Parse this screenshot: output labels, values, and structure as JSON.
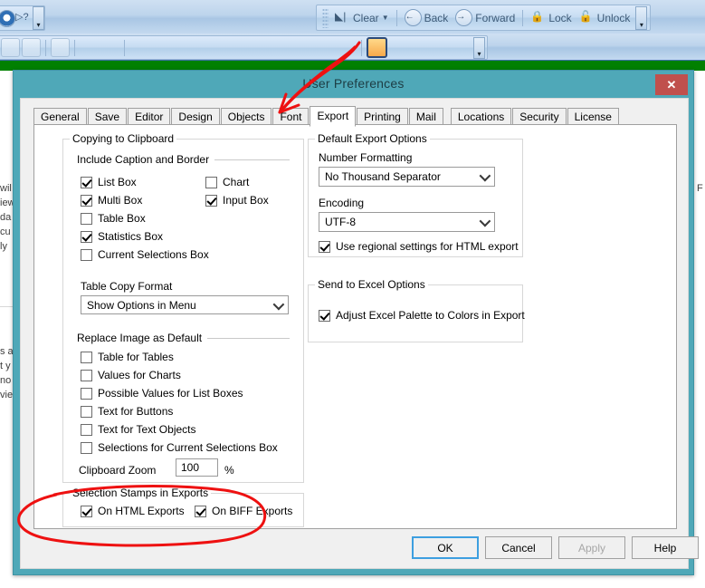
{
  "toolbar": {
    "row1_buttons": [
      {
        "name": "clear-button",
        "label": "Clear",
        "icon": "clear-icon",
        "has_dropdown": true
      },
      {
        "name": "back-button",
        "label": "Back",
        "icon": "back-arrow-icon"
      },
      {
        "name": "forward-button",
        "label": "Forward",
        "icon": "forward-arrow-icon"
      },
      {
        "name": "lock-button",
        "label": "Lock",
        "icon": "lock-closed-icon"
      },
      {
        "name": "unlock-button",
        "label": "Unlock",
        "icon": "lock-open-icon"
      }
    ],
    "row1_left_icons": [
      "edit-icon",
      "help-question-icon",
      "context-help-icon"
    ],
    "row2_icons": [
      "star-icon",
      "zoom-icon",
      "layout-icon",
      "smiley-icon",
      "chart-icon",
      "brush-icon",
      "crop-icon",
      "align-left-icon",
      "align-center-icon",
      "align-right-icon",
      "distribute-horizontal-icon",
      "distribute-vertical-icon",
      "space-evenly-icon",
      "size-equal-icon",
      "size-width-icon",
      "size-height-icon",
      "shrink-icon",
      "order-icon",
      "user-preferences-icon",
      "document-properties-icon",
      "edit-script-icon",
      "connect-icon",
      "export-icon"
    ],
    "selected_icon": "user-preferences-icon",
    "overflow_label": "▾"
  },
  "background_document": {
    "left_lines": [
      "wil",
      "iew",
      "da",
      "cu",
      "ly",
      "s a",
      "t y",
      "no",
      "vie"
    ],
    "right_lines": [
      "F"
    ]
  },
  "dialog": {
    "title": "User Preferences",
    "close_label": "✕",
    "tabs": [
      {
        "name": "tab-general",
        "label": "General",
        "active": false
      },
      {
        "name": "tab-save",
        "label": "Save",
        "active": false
      },
      {
        "name": "tab-editor",
        "label": "Editor",
        "active": false
      },
      {
        "name": "tab-design",
        "label": "Design",
        "active": false
      },
      {
        "name": "tab-objects",
        "label": "Objects",
        "active": false
      },
      {
        "name": "tab-font",
        "label": "Font",
        "active": false
      },
      {
        "name": "tab-export",
        "label": "Export",
        "active": true
      },
      {
        "name": "tab-printing",
        "label": "Printing",
        "active": false
      },
      {
        "name": "tab-mail",
        "label": "Mail",
        "active": false
      },
      {
        "name": "tab-locations",
        "label": "Locations",
        "active": false,
        "gap": true
      },
      {
        "name": "tab-security",
        "label": "Security",
        "active": false
      },
      {
        "name": "tab-license",
        "label": "License",
        "active": false
      }
    ],
    "buttons": [
      {
        "name": "ok-button",
        "label": "OK",
        "state": "focused"
      },
      {
        "name": "cancel-button",
        "label": "Cancel",
        "state": "normal"
      },
      {
        "name": "apply-button",
        "label": "Apply",
        "state": "disabled"
      },
      {
        "name": "help-button",
        "label": "Help",
        "state": "normal"
      }
    ]
  },
  "clipboard_group": {
    "legend": "Copying to Clipboard",
    "include_caption_legend": "Include Caption and Border",
    "checks_left": [
      {
        "name": "checkbox-list-box",
        "label": "List Box",
        "checked": true
      },
      {
        "name": "checkbox-multi-box",
        "label": "Multi Box",
        "checked": true
      },
      {
        "name": "checkbox-table-box",
        "label": "Table Box",
        "checked": false
      },
      {
        "name": "checkbox-statistics-box",
        "label": "Statistics Box",
        "checked": true
      },
      {
        "name": "checkbox-current-selections-box",
        "label": "Current Selections Box",
        "checked": false
      }
    ],
    "checks_right": [
      {
        "name": "checkbox-chart",
        "label": "Chart",
        "checked": false
      },
      {
        "name": "checkbox-input-box",
        "label": "Input Box",
        "checked": true
      }
    ],
    "table_copy_format_label": "Table Copy Format",
    "table_copy_format_value": "Show Options in Menu",
    "replace_image_legend": "Replace Image as Default",
    "replace_checks": [
      {
        "name": "checkbox-table-for-tables",
        "label": "Table for Tables",
        "checked": false
      },
      {
        "name": "checkbox-values-for-charts",
        "label": "Values for Charts",
        "checked": false
      },
      {
        "name": "checkbox-possible-values-for-list-boxes",
        "label": "Possible Values for List Boxes",
        "checked": false
      },
      {
        "name": "checkbox-text-for-buttons",
        "label": "Text for Buttons",
        "checked": false
      },
      {
        "name": "checkbox-text-for-text-objects",
        "label": "Text for Text Objects",
        "checked": false
      },
      {
        "name": "checkbox-selections-for-current-selections",
        "label": "Selections for Current Selections Box",
        "checked": false
      }
    ],
    "clipboard_zoom_label": "Clipboard Zoom",
    "clipboard_zoom_value": "100",
    "clipboard_zoom_unit": "%"
  },
  "export_options_group": {
    "legend": "Default Export Options",
    "number_formatting_label": "Number Formatting",
    "number_formatting_value": "No Thousand Separator",
    "encoding_label": "Encoding",
    "encoding_value": "UTF-8",
    "regional_checkbox": {
      "name": "checkbox-use-regional-settings",
      "label": "Use regional settings for HTML export",
      "checked": true
    }
  },
  "excel_group": {
    "legend": "Send to Excel Options",
    "palette_checkbox": {
      "name": "checkbox-adjust-excel-palette",
      "label": "Adjust Excel Palette to Colors in Export",
      "checked": true
    }
  },
  "stamps_group": {
    "legend": "Selection Stamps in Exports",
    "checks": [
      {
        "name": "checkbox-on-html-exports",
        "label": "On HTML Exports",
        "checked": true
      },
      {
        "name": "checkbox-on-biff-exports",
        "label": "On BIFF Exports",
        "checked": true
      }
    ]
  },
  "annotations": {
    "arrow_color": "#ee1111",
    "ellipse_color": "#ee1111",
    "arrow_target": "tab-export",
    "ellipse_target": "stamps-group"
  },
  "colors": {
    "dialog_frame": "#4fa8b8",
    "close_button": "#c0504d",
    "green_bar": "#018001",
    "toolbar": "#bdd4ec",
    "focus_border": "#3d9fe0",
    "annotation_red": "#ee1111"
  }
}
